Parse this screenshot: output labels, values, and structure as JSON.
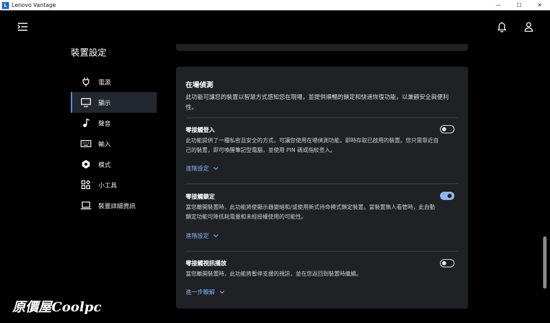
{
  "window": {
    "title": "Lenovo Vantage",
    "logo_letter": "L",
    "minimize": "—",
    "maximize": "☐",
    "close": "✕"
  },
  "sidebar": {
    "title": "裝置設定",
    "items": [
      {
        "label": "電源",
        "icon": "power-plug-icon",
        "active": false
      },
      {
        "label": "顯示",
        "icon": "monitor-icon",
        "active": true
      },
      {
        "label": "聲音",
        "icon": "music-note-icon",
        "active": false
      },
      {
        "label": "輸入",
        "icon": "keyboard-icon",
        "active": false
      },
      {
        "label": "模式",
        "icon": "hexagon-mode-icon",
        "active": false
      },
      {
        "label": "小工具",
        "icon": "widgets-icon",
        "active": false
      },
      {
        "label": "裝置詳細資訊",
        "icon": "laptop-icon",
        "active": false
      }
    ]
  },
  "presence": {
    "title": "在場偵測",
    "description": "此功能可讓您的裝置以智慧方式感知您在現場，並提供順暢的鎖定和快速恢復功能，以兼顧安全與便利性。",
    "settings": [
      {
        "title": "零接觸登入",
        "description": "此功能提供了一種私密且安全的方式，可讓您使用在場偵測功能，即時存取已啟用的裝置。您只需靠近自己的裝置，即可喚醒筆記型電腦，並使用 PIN 碼或指紋登入。",
        "link": "進階設定",
        "enabled": false
      },
      {
        "title": "零接觸鎖定",
        "description": "當您離開裝置時，此功能將使顯示器變暗和/或使用新式待命模式鎖定裝置。當裝置無人看管時，此自動鎖定功能可降低耗電量和未經授權使用的可能性。",
        "link": "進階設定",
        "enabled": true
      },
      {
        "title": "零接觸視訊播放",
        "description": "當您離開裝置時，此功能將暫停支援的視訊，並在您返回到裝置時繼續。",
        "link": "進一步瞭解",
        "enabled": false
      }
    ]
  },
  "watermark": "原價屋Coolpc",
  "colors": {
    "background": "#000000",
    "card": "#1f2125",
    "accent": "#4f92e6",
    "link": "#7fb2f0",
    "toggle_on": "#8fb4ef"
  }
}
